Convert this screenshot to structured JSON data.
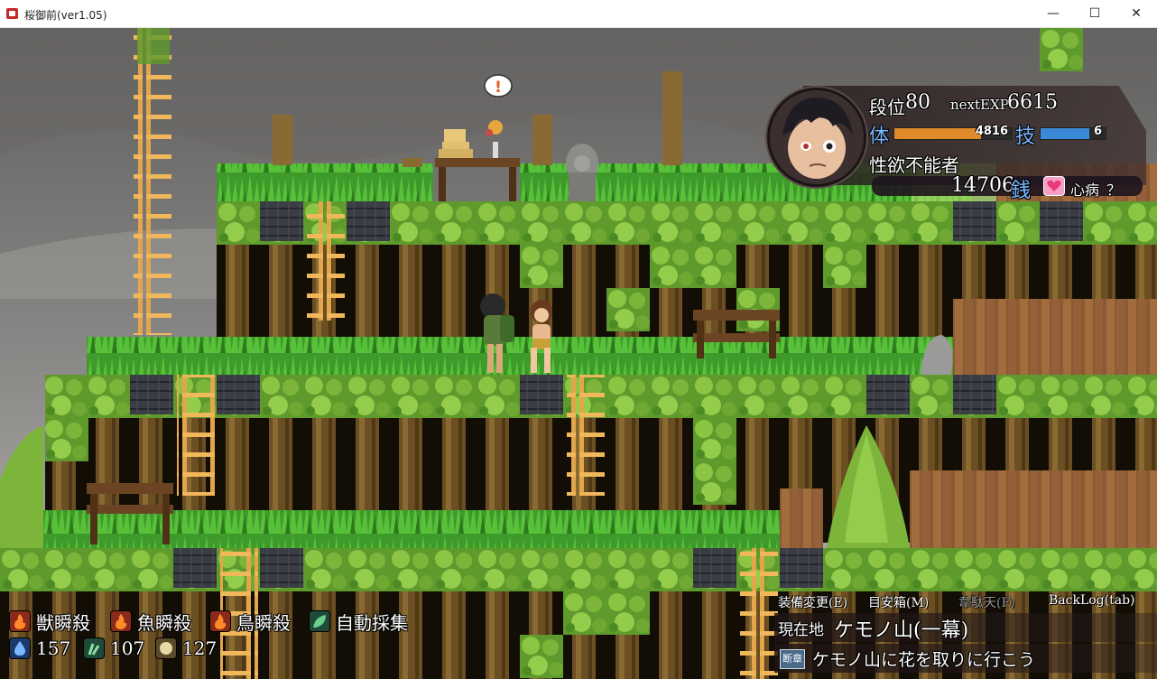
{
  "window": {
    "title": "桜御前(ver1.05)",
    "minimize": "—",
    "maximize": "☐",
    "close": "✕"
  },
  "status": {
    "rank_label": "段位",
    "rank_value": "80",
    "next_exp_label": "nextEXP",
    "next_exp_value": "6615",
    "hp_label": "体",
    "hp_value": "4816",
    "hp_fraction": 0.74,
    "sp_label": "技",
    "sp_value": "6",
    "sp_fraction": 0.75,
    "status_text": "性欲不能者",
    "money_value": "14706",
    "money_unit": "銭",
    "disease_label": "心病",
    "disease_value": "？"
  },
  "skills": [
    {
      "label": "獣瞬殺",
      "icon": "fire-icon"
    },
    {
      "label": "魚瞬殺",
      "icon": "fire-icon"
    },
    {
      "label": "鳥瞬殺",
      "icon": "fire-icon"
    },
    {
      "label": "自動採集",
      "icon": "leaf-icon"
    }
  ],
  "resources": [
    {
      "icon": "water-drop-icon",
      "value": "157"
    },
    {
      "icon": "herb-icon",
      "value": "107"
    },
    {
      "icon": "ore-icon",
      "value": "127"
    }
  ],
  "menu": {
    "equip": "装備変更(E)",
    "goal": "目安箱(M)",
    "idaten": "韋駄天(F)",
    "backlog": "BackLog(tab)"
  },
  "location": {
    "label": "現在地",
    "value": "ケモノ山(一幕)"
  },
  "quest": {
    "badge": "断章",
    "text": "ケモノ山に花を取りに行こう"
  },
  "npc_alert": "!",
  "colors": {
    "grass": "#3f9b2b",
    "bush": "#79b83a",
    "trunk": "#6b4e22",
    "sky": "#7a7a78",
    "hp_bar": "#e08a2a",
    "sp_bar": "#3a8ad8"
  }
}
